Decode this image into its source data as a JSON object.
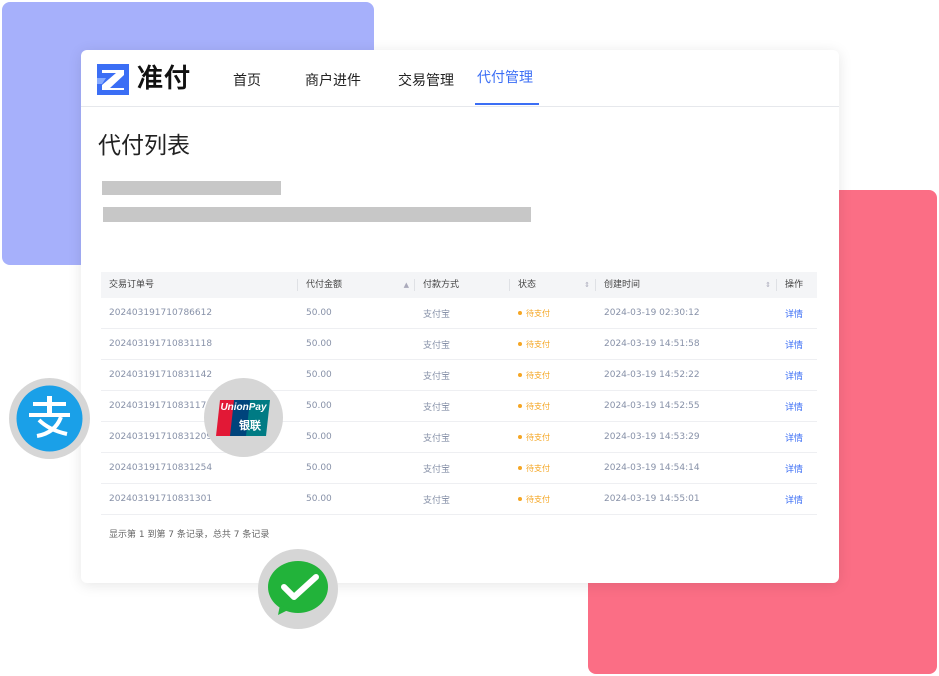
{
  "brand": {
    "name": "准付",
    "color": "#3b6ef5"
  },
  "nav": {
    "items": [
      {
        "label": "首页"
      },
      {
        "label": "商户进件"
      },
      {
        "label": "交易管理"
      },
      {
        "label": "代付管理",
        "active": true
      }
    ]
  },
  "page": {
    "title": "代付列表"
  },
  "table": {
    "columns": [
      "交易订单号",
      "代付金额",
      "付款方式",
      "状态",
      "创建时间",
      "操作"
    ],
    "rows": [
      {
        "order_no": "202403191710786612",
        "amount": "50.00",
        "method": "支付宝",
        "status": "待支付",
        "created": "2024-03-19 02:30:12",
        "action": "详情"
      },
      {
        "order_no": "202403191710831118",
        "amount": "50.00",
        "method": "支付宝",
        "status": "待支付",
        "created": "2024-03-19 14:51:58",
        "action": "详情"
      },
      {
        "order_no": "202403191710831142",
        "amount": "50.00",
        "method": "支付宝",
        "status": "待支付",
        "created": "2024-03-19 14:52:22",
        "action": "详情"
      },
      {
        "order_no": "202403191710831175",
        "amount": "50.00",
        "method": "支付宝",
        "status": "待支付",
        "created": "2024-03-19 14:52:55",
        "action": "详情"
      },
      {
        "order_no": "202403191710831209",
        "amount": "50.00",
        "method": "支付宝",
        "status": "待支付",
        "created": "2024-03-19 14:53:29",
        "action": "详情"
      },
      {
        "order_no": "202403191710831254",
        "amount": "50.00",
        "method": "支付宝",
        "status": "待支付",
        "created": "2024-03-19 14:54:14",
        "action": "详情"
      },
      {
        "order_no": "202403191710831301",
        "amount": "50.00",
        "method": "支付宝",
        "status": "待支付",
        "created": "2024-03-19 14:55:01",
        "action": "详情"
      }
    ],
    "footer": "显示第 1 到第 7 条记录，总共 7 条记录"
  },
  "icons": {
    "alipay": {
      "name": "alipay-icon",
      "color": "#1aa0e8"
    },
    "unionpay": {
      "name": "unionpay-icon",
      "text_top": "UnionPay",
      "text_bottom": "银联"
    },
    "wechat": {
      "name": "wechat-pay-icon",
      "color": "#22b33a"
    }
  },
  "colors": {
    "deco_blue": "#a6b0fb",
    "deco_pink": "#fb6e85",
    "status_pending": "#f5a623"
  }
}
